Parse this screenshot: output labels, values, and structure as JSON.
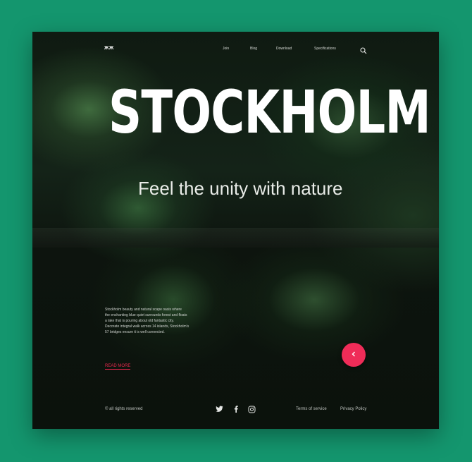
{
  "brand": {
    "logo": "ЖЖ"
  },
  "nav": {
    "items": [
      "Join",
      "Blog",
      "Download",
      "Specifications"
    ],
    "search_icon": "search-icon"
  },
  "hero": {
    "title": "STOCKHOLM",
    "subtitle": "Feel the unity with nature"
  },
  "content": {
    "description_lines": [
      "Stockholm beauty and natural scape oasis where",
      "the enchanting blue quiet surrounds forest and floats",
      "a lake that is pouring about old fantastic city.",
      "Decorate integral walk across 14 islands, Stockholm's",
      "57 bridges ensure it is well connected."
    ],
    "read_more": "READ MORE",
    "fab_icon": "chevron-left-icon"
  },
  "footer": {
    "left_text": "© all rights reserved",
    "social_icons": [
      "twitter-icon",
      "facebook-icon",
      "instagram-icon"
    ],
    "right_links": [
      "Terms of service",
      "Privacy Policy"
    ]
  },
  "colors": {
    "background": "#14966e",
    "accent": "#ef2c58",
    "card": "#0f1a11"
  }
}
